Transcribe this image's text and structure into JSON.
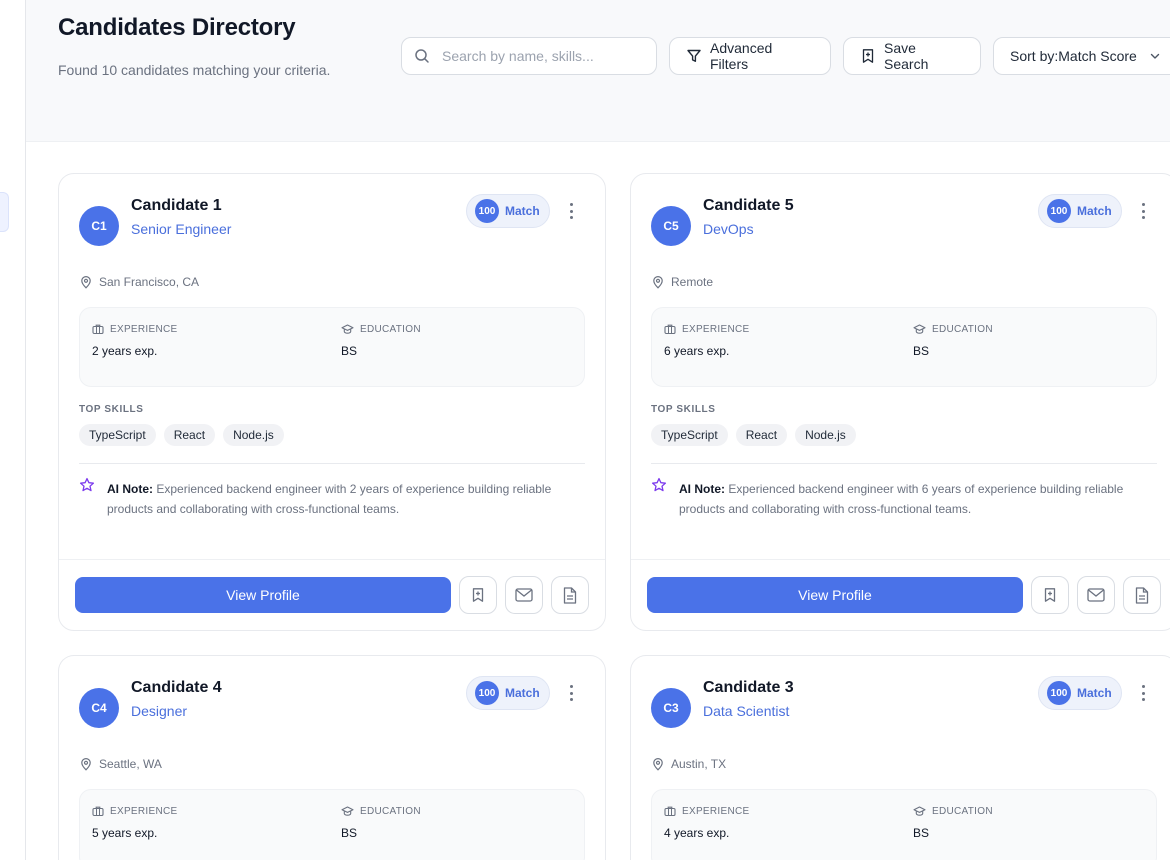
{
  "header": {
    "title": "Candidates Directory",
    "subtitle": "Found 10 candidates matching your criteria.",
    "search_placeholder": "Search by name, skills...",
    "filters_label": "Advanced Filters",
    "save_label": "Save Search",
    "sort_label": "Sort by:Match Score"
  },
  "labels": {
    "match": "Match",
    "experience": "EXPERIENCE",
    "education": "EDUCATION",
    "top_skills": "TOP SKILLS",
    "ai_note": "AI Note:",
    "view_profile": "View Profile"
  },
  "colors": {
    "accent": "#4a72e8",
    "ai_star": "#7c3aed"
  },
  "candidates": [
    {
      "initials": "C1",
      "name": "Candidate 1",
      "role": "Senior Engineer",
      "score": "100",
      "location": "San Francisco, CA",
      "experience": "2 years exp.",
      "education": "BS",
      "skills": [
        "TypeScript",
        "React",
        "Node.js"
      ],
      "note": "Experienced backend engineer with 2 years of experience building reliable products and collaborating with cross-functional teams."
    },
    {
      "initials": "C5",
      "name": "Candidate 5",
      "role": "DevOps",
      "score": "100",
      "location": "Remote",
      "experience": "6 years exp.",
      "education": "BS",
      "skills": [
        "TypeScript",
        "React",
        "Node.js"
      ],
      "note": "Experienced backend engineer with 6 years of experience building reliable products and collaborating with cross-functional teams."
    },
    {
      "initials": "C4",
      "name": "Candidate 4",
      "role": "Designer",
      "score": "100",
      "location": "Seattle, WA",
      "experience": "5 years exp.",
      "education": "BS"
    },
    {
      "initials": "C3",
      "name": "Candidate 3",
      "role": "Data Scientist",
      "score": "100",
      "location": "Austin, TX",
      "experience": "4 years exp.",
      "education": "BS"
    }
  ]
}
